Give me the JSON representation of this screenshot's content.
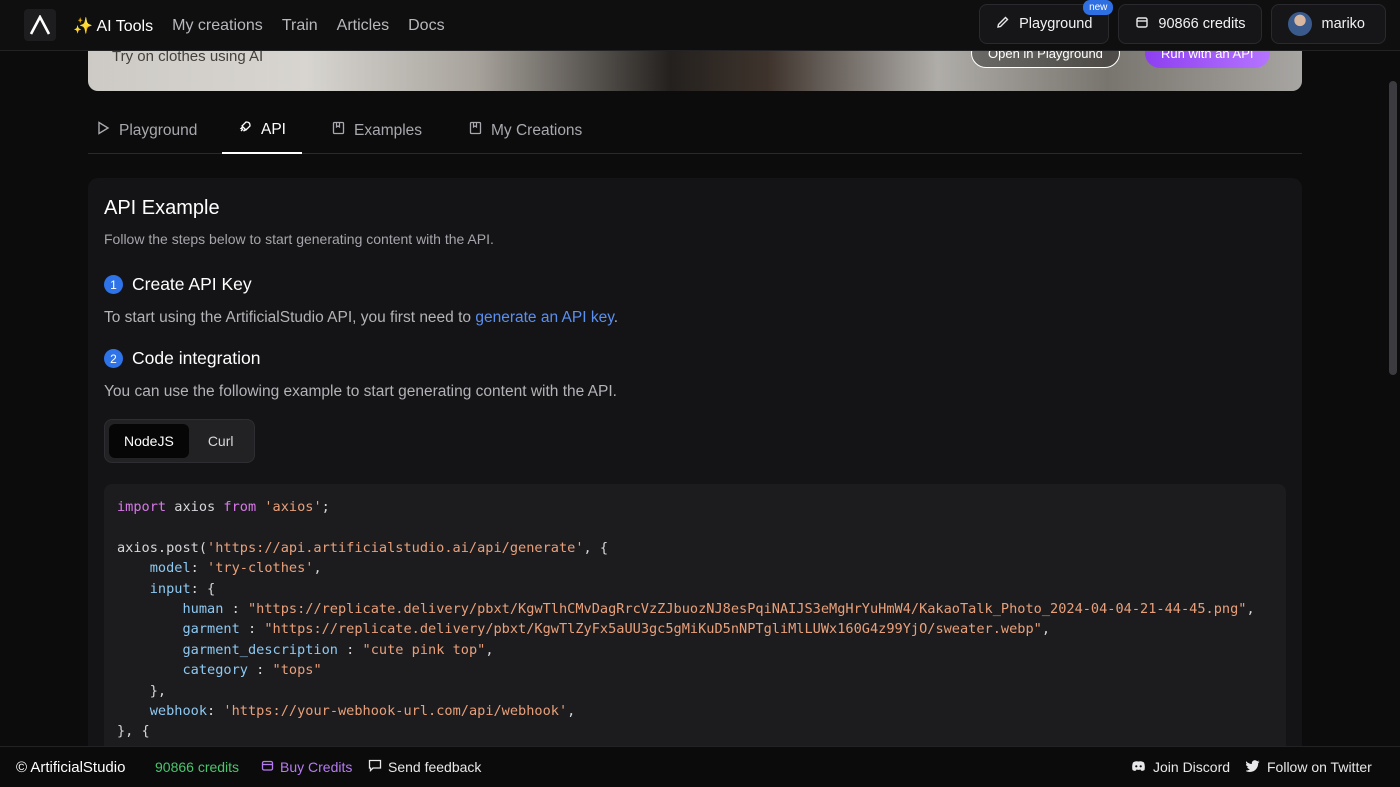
{
  "nav": {
    "links": [
      "✨ AI Tools",
      "My creations",
      "Train",
      "Articles",
      "Docs"
    ],
    "playground_label": "Playground",
    "new_badge": "new",
    "credits_label": "90866 credits",
    "user_name": "mariko"
  },
  "hero": {
    "subtitle": "Try on clothes using AI",
    "open_playground": "Open in Playground",
    "run_api": "Run with an API"
  },
  "tabs": [
    "Playground",
    "API",
    "Examples",
    "My Creations"
  ],
  "card": {
    "title": "API Example",
    "subtitle": "Follow the steps below to start generating content with the API.",
    "step1_num": "1",
    "step1_title": "Create API Key",
    "step1_text": "To start using the ArtificialStudio API, you first need to ",
    "step1_link": "generate an API key",
    "step1_end": ".",
    "step2_num": "2",
    "step2_title": "Code integration",
    "step2_text": "You can use the following example to start generating content with the API.",
    "lang_options": [
      "NodeJS",
      "Curl"
    ]
  },
  "code": {
    "line1_import": "import",
    "line1_mid": " axios ",
    "line1_from": "from",
    "line1_str": "'axios'",
    "line3_a": "axios.post(",
    "line3_url": "'https://api.artificialstudio.ai/api/generate'",
    "line3_b": ", {",
    "model_key": "model",
    "model_val": "'try-clothes'",
    "input_key": "input",
    "human_key": "human",
    "human_val": "\"https://replicate.delivery/pbxt/KgwTlhCMvDagRrcVzZJbuozNJ8esPqiNAIJS3eMgHrYuHmW4/KakaoTalk_Photo_2024-04-04-21-44-45.png\"",
    "garment_key": "garment",
    "garment_val": "\"https://replicate.delivery/pbxt/KgwTlZyFx5aUU3gc5gMiKuD5nNPTgliMlLUWx160G4z99YjO/sweater.webp\"",
    "desc_key": "garment_description",
    "desc_val": "\"cute pink top\"",
    "category_key": "category",
    "category_val": "\"tops\"",
    "webhook_key": "webhook",
    "webhook_val": "'https://your-webhook-url.com/api/webhook'",
    "last_line": "}, {"
  },
  "footer": {
    "brand": "© ArtificialStudio",
    "credits": "90866 credits",
    "buy": "Buy Credits",
    "feedback": "Send feedback",
    "discord": "Join Discord",
    "twitter": "Follow on Twitter"
  },
  "colors": {
    "accent_blue": "#2f73e8",
    "credits_green": "#4dc46e",
    "buy_purple": "#b57cf0"
  }
}
